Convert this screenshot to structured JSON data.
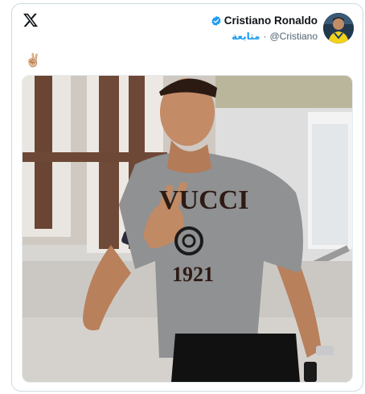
{
  "tweet": {
    "author_name": "Cristiano Ronaldo",
    "handle": "@Cristiano",
    "follow_label": "متابعة",
    "separator": "·",
    "text": "✌🏼",
    "shirt_brand": "VUCCI",
    "shirt_year": "1921"
  },
  "icons": {
    "logo": "x-logo-icon",
    "verified": "verified-badge-icon"
  },
  "colors": {
    "accent": "#1d9bf0",
    "text_primary": "#0f1419",
    "text_secondary": "#536471",
    "border": "#cfd9de"
  }
}
